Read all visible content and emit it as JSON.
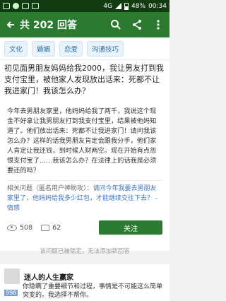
{
  "status_bar": {
    "network": "4G",
    "battery": "48%",
    "time": "00:34"
  },
  "app_bar": {
    "title": "共 202 回答",
    "icons": [
      "back-icon",
      "search-icon",
      "share-icon",
      "more-icon"
    ]
  },
  "tags": [
    "文化",
    "婚姻",
    "恋爱",
    "沟通技巧"
  ],
  "question": "初见面男朋友妈妈给我2000，我让男友打到我支付宝里，被他家人发现放出话来：死都不让我进家门！我该怎么办？",
  "description": "今年去男朋友家里，他妈妈给我了两千，我说这个现金不好拿让我男朋友打到我支付宝里，结果被他妈知道了。他们放出话来：死都不让我进家门！请问我该怎么办？这样的话我男朋友肯定会跟我分手，他们家人肯定让我还钱，到时候人财两空。现在开始有点怨恨支付宝了……我该怎么办？在法律上的话我是必须要还的吗？",
  "related": {
    "label": "相关问题（匿名用户神助攻）：",
    "link": "请问今年我要去男朋友家里了，他妈妈给我多少红包，才能继续交往下去？ - 情感"
  },
  "stats": {
    "views": "508",
    "comments": "62",
    "follow_label": "关注"
  },
  "notice": "该问题已被锁定，无法添加新回答",
  "answer": {
    "author": "迷人的人生赢家",
    "votes": "998",
    "excerpt": "你隐瞒了重要细节和过程，事情是不可能这么简单突变的。我选择不帮你。"
  },
  "colors": {
    "app_bar": "#2b7a2f",
    "status_bar": "#123b12",
    "link": "#3a74c0"
  }
}
